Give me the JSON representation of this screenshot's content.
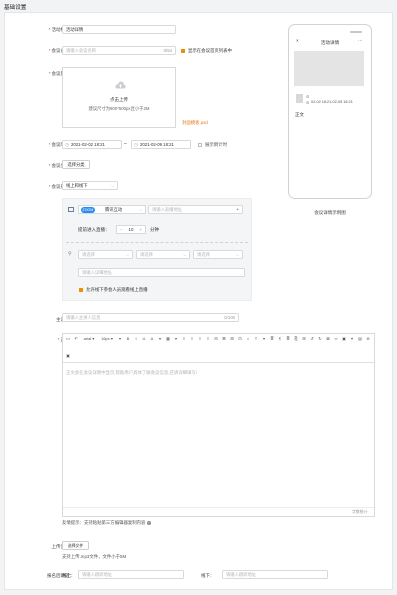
{
  "page": {
    "title": "基础设置"
  },
  "form": {
    "title": {
      "label": "活动标题：",
      "value": "活动详情"
    },
    "meeting_name": {
      "label": "会议名称：",
      "placeholder": "请输入会议名称",
      "counter": "0/64",
      "show_on_page_label": "显示在会议首页列表中"
    },
    "cover": {
      "label": "会议封面：",
      "upload_label": "点击上传",
      "hint": "建议尺寸为900*500px且小于2M",
      "template_link": "封面模板.psd"
    },
    "time": {
      "label": "会议时间：",
      "start": "2021-02-02 18:21",
      "sep": "–",
      "end": "2021-02-09 18:21",
      "countdown_label": "展示倒计时"
    },
    "category": {
      "label": "会议分类：",
      "button": "选择分类"
    },
    "format": {
      "label": "会议形式：",
      "value": "线上和线下",
      "live": {
        "brand": "ZOOM",
        "platform": "腾讯互动",
        "address_placeholder": "请输入直播地址",
        "enter_early_label": "提前进入直播：",
        "minutes": "10",
        "unit": "分钟"
      },
      "offline": {
        "province": "请选择",
        "city": "请选择",
        "district": "请选择",
        "address_placeholder": "请输入详细地址",
        "allow_label": "允许线下参会人员观看线上直播"
      }
    },
    "speaker": {
      "label": "主讲人：",
      "placeholder": "请输入主讲人信息",
      "counter": "0/100"
    },
    "body": {
      "label": "正文：",
      "toolbar_row1": [
        "<>",
        "↶",
        "arial ▾",
        "16px ▾",
        "▾",
        "B",
        "I",
        "U",
        "A",
        "▾",
        "▦",
        "▾",
        "≡",
        "≡",
        "≡",
        "≡",
        "⊟",
        "⌘",
        "⊞",
        "⊡",
        "⌂",
        "T",
        "▾",
        "≣",
        "¶",
        "≣",
        "⎘",
        "⊞",
        "↺",
        "↻",
        "⊠",
        "∞",
        "▣",
        "⌖",
        "▤",
        "⊚"
      ],
      "toolbar_row2": [
        "▣"
      ],
      "placeholder": "正文会在会议详情中显示,帮助用户具体了解会议信息,还请详细填写!",
      "word_count": "字数统计",
      "tip": "友情提示：支持粘贴第三方编辑器复制内容"
    },
    "upload_doc": {
      "label": "上传资料：",
      "button": "选择文件",
      "hint": "支持上传.mp3文件，文件小于5M"
    },
    "signup_link": {
      "label": "报名后跳转：",
      "online_label": "线上：",
      "online_placeholder": "请输入跳转地址",
      "offline_label": "线下：",
      "offline_placeholder": "请输入跳转地址"
    }
  },
  "preview": {
    "caption": "会议详情示例图",
    "phone_title": "活动详情",
    "datetime": "02-02 18:21-02-09 18:21",
    "body_label": "正文"
  }
}
